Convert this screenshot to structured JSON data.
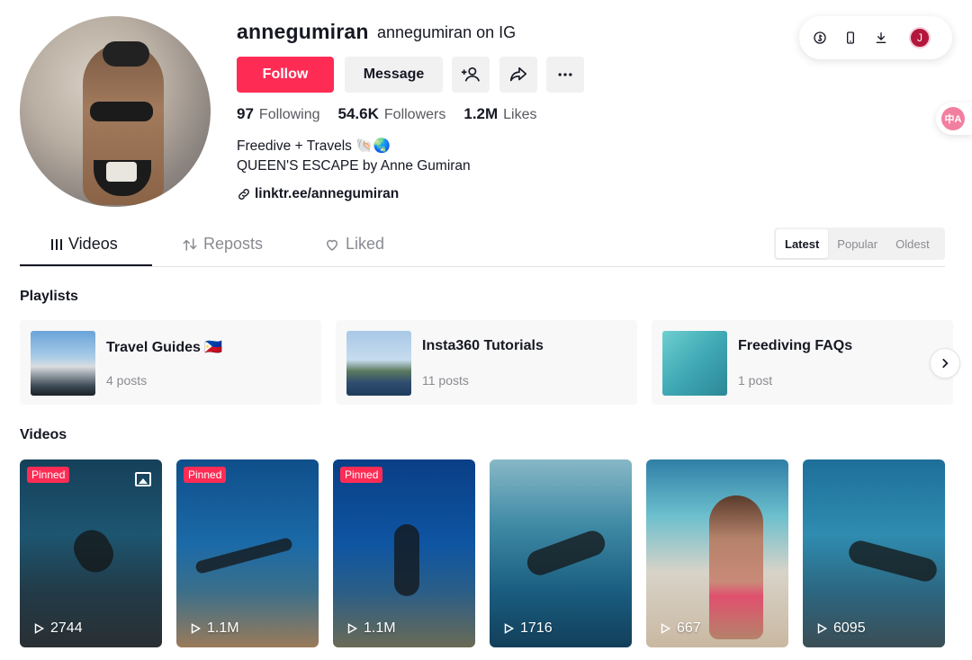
{
  "profile": {
    "username": "annegumiran",
    "nickname": "annegumiran on IG",
    "buttons": {
      "follow": "Follow",
      "message": "Message"
    },
    "stats": [
      {
        "value": "97",
        "label": "Following"
      },
      {
        "value": "54.6K",
        "label": "Followers"
      },
      {
        "value": "1.2M",
        "label": "Likes"
      }
    ],
    "bio_line1": "Freedive + Travels 🐚🌏",
    "bio_line2": "QUEEN'S ESCAPE by Anne Gumiran",
    "link": "linktr.ee/annegumiran"
  },
  "toolbar": {
    "avatar_initial": "J"
  },
  "translate_label": "中A",
  "tabs": [
    {
      "label": "Videos",
      "icon": "grid-icon"
    },
    {
      "label": "Reposts",
      "icon": "repost-icon"
    },
    {
      "label": "Liked",
      "icon": "heart-icon"
    }
  ],
  "sort": [
    "Latest",
    "Popular",
    "Oldest"
  ],
  "playlists_title": "Playlists",
  "playlists": [
    {
      "name": "Travel Guides 🇵🇭",
      "count": "4 posts"
    },
    {
      "name": "Insta360 Tutorials",
      "count": "11 posts"
    },
    {
      "name": "Freediving FAQs",
      "count": "1 post"
    }
  ],
  "videos_title": "Videos",
  "videos": [
    {
      "views": "2744",
      "pinned": "Pinned"
    },
    {
      "views": "1.1M",
      "pinned": "Pinned"
    },
    {
      "views": "1.1M",
      "pinned": "Pinned"
    },
    {
      "views": "1716"
    },
    {
      "views": "667"
    },
    {
      "views": "6095"
    }
  ]
}
